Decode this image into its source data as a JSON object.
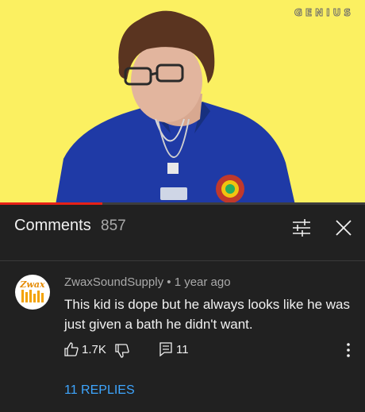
{
  "video": {
    "watermark": "GENIUS",
    "progress_fraction": 0.28,
    "colors": {
      "background": "#fbf061",
      "progress": "#e62117"
    }
  },
  "comments_panel": {
    "title": "Comments",
    "count": "857",
    "filter_icon": "sliders-icon",
    "close_icon": "close-icon"
  },
  "comment": {
    "avatar_text": "Zwax",
    "author": "ZwaxSoundSupply",
    "separator": "•",
    "time": "1 year ago",
    "text": "This kid is dope but he always looks like he was just given a bath he didn't want.",
    "likes": "1.7K",
    "reply_count": "11",
    "replies_link": "11 REPLIES",
    "icons": [
      "thumbs-up-icon",
      "thumbs-down-icon",
      "reply-icon",
      "more-vert-icon"
    ]
  }
}
